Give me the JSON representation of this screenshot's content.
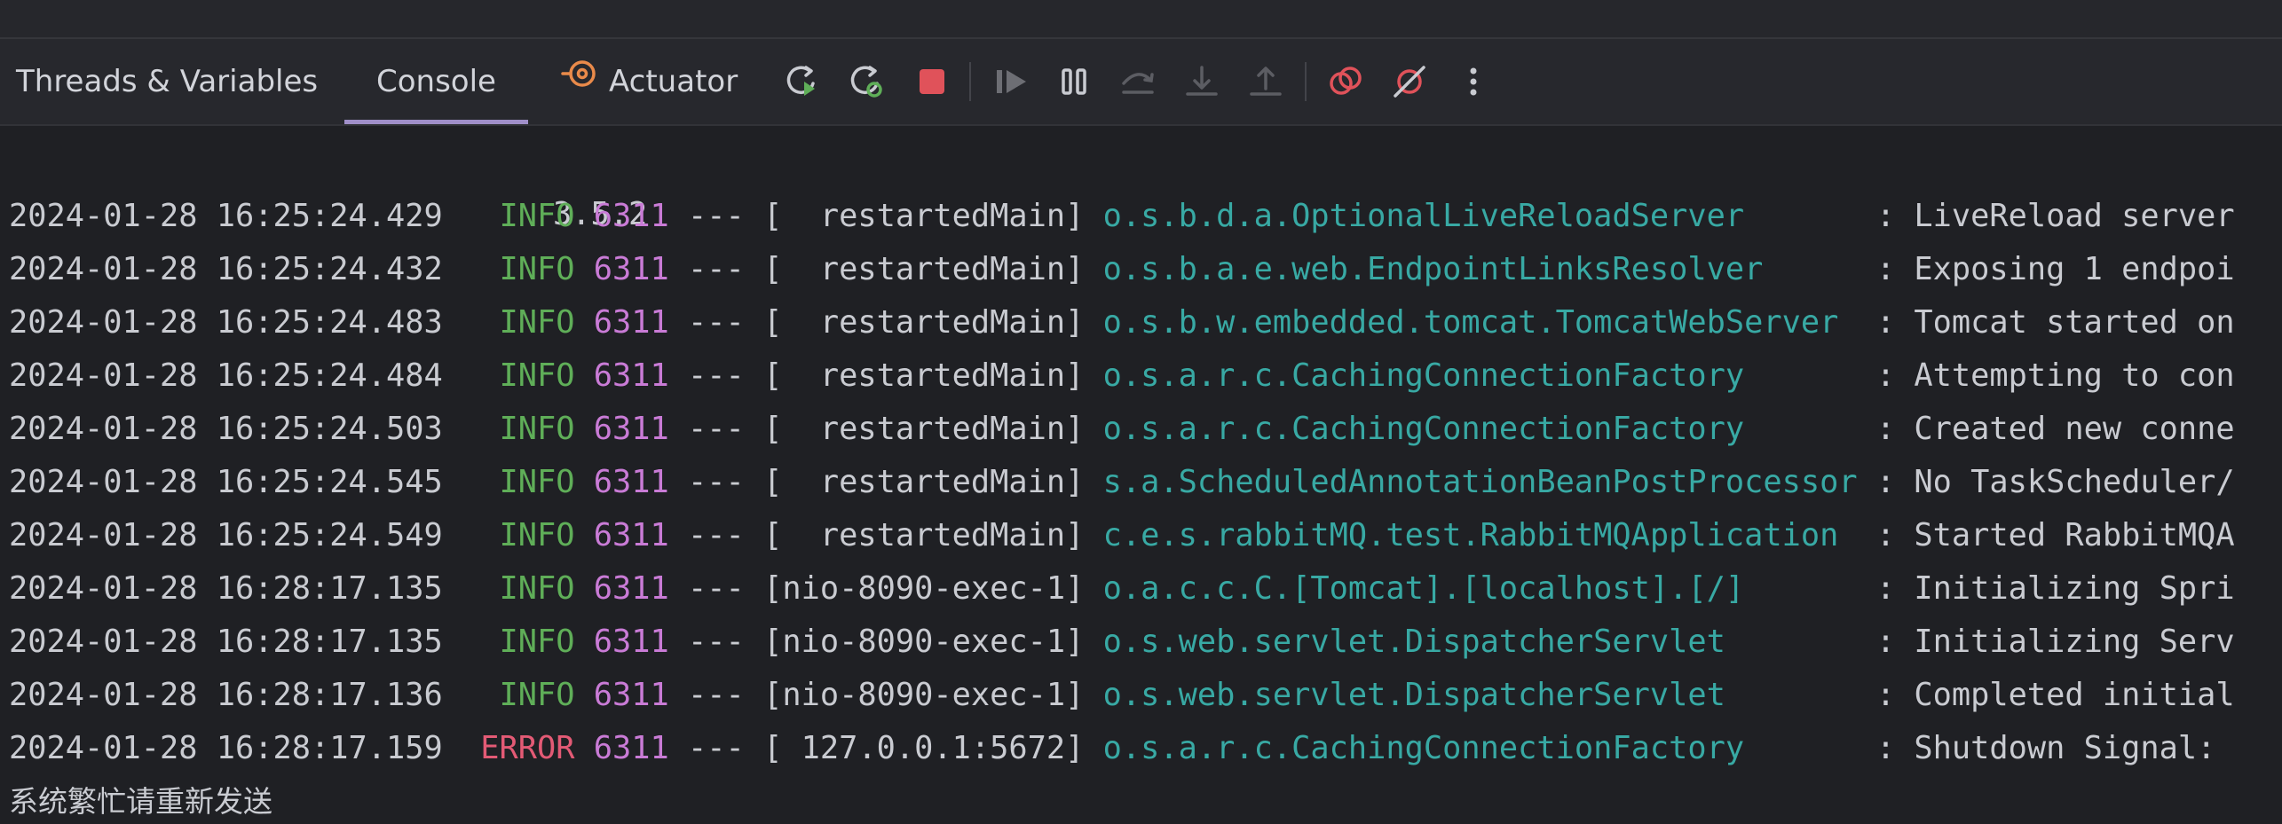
{
  "tabs": [
    {
      "label": "Threads & Variables"
    },
    {
      "label": "Console"
    },
    {
      "label": "Actuator"
    }
  ],
  "active_tab": "Console",
  "colors": {
    "info": "#5fae58",
    "error": "#e35a75",
    "pid": "#c97bd6",
    "logger": "#38a9a4",
    "text": "#c9cbd1",
    "tab_underline": "#a08fc9",
    "stop": "#e0525a"
  },
  "toolbar_icons": [
    "rerun-icon",
    "restart-icon",
    "stop-icon",
    "resume-icon",
    "pause-icon",
    "step-over-icon",
    "step-into-icon",
    "step-out-icon",
    "view-breakpoints-icon",
    "mute-breakpoints-icon",
    "more-icon"
  ],
  "console": {
    "version": "3.5.2",
    "lines": [
      {
        "ts": "2024-01-28 16:25:24.429",
        "level": "INFO",
        "pid": "6311",
        "sep": "---",
        "thread": "[  restartedMain]",
        "logger": "o.s.b.d.a.OptionalLiveReloadServer",
        "msg": ": LiveReload server"
      },
      {
        "ts": "2024-01-28 16:25:24.432",
        "level": "INFO",
        "pid": "6311",
        "sep": "---",
        "thread": "[  restartedMain]",
        "logger": "o.s.b.a.e.web.EndpointLinksResolver",
        "msg": ": Exposing 1 endpoi"
      },
      {
        "ts": "2024-01-28 16:25:24.483",
        "level": "INFO",
        "pid": "6311",
        "sep": "---",
        "thread": "[  restartedMain]",
        "logger": "o.s.b.w.embedded.tomcat.TomcatWebServer",
        "msg": ": Tomcat started on"
      },
      {
        "ts": "2024-01-28 16:25:24.484",
        "level": "INFO",
        "pid": "6311",
        "sep": "---",
        "thread": "[  restartedMain]",
        "logger": "o.s.a.r.c.CachingConnectionFactory",
        "msg": ": Attempting to con"
      },
      {
        "ts": "2024-01-28 16:25:24.503",
        "level": "INFO",
        "pid": "6311",
        "sep": "---",
        "thread": "[  restartedMain]",
        "logger": "o.s.a.r.c.CachingConnectionFactory",
        "msg": ": Created new conne"
      },
      {
        "ts": "2024-01-28 16:25:24.545",
        "level": "INFO",
        "pid": "6311",
        "sep": "---",
        "thread": "[  restartedMain]",
        "logger": "s.a.ScheduledAnnotationBeanPostProcessor",
        "msg": ": No TaskScheduler/"
      },
      {
        "ts": "2024-01-28 16:25:24.549",
        "level": "INFO",
        "pid": "6311",
        "sep": "---",
        "thread": "[  restartedMain]",
        "logger": "c.e.s.rabbitMQ.test.RabbitMQApplication",
        "msg": ": Started RabbitMQA"
      },
      {
        "ts": "2024-01-28 16:28:17.135",
        "level": "INFO",
        "pid": "6311",
        "sep": "---",
        "thread": "[nio-8090-exec-1]",
        "logger": "o.a.c.c.C.[Tomcat].[localhost].[/]",
        "msg": ": Initializing Spri"
      },
      {
        "ts": "2024-01-28 16:28:17.135",
        "level": "INFO",
        "pid": "6311",
        "sep": "---",
        "thread": "[nio-8090-exec-1]",
        "logger": "o.s.web.servlet.DispatcherServlet",
        "msg": ": Initializing Serv"
      },
      {
        "ts": "2024-01-28 16:28:17.136",
        "level": "INFO",
        "pid": "6311",
        "sep": "---",
        "thread": "[nio-8090-exec-1]",
        "logger": "o.s.web.servlet.DispatcherServlet",
        "msg": ": Completed initial"
      },
      {
        "ts": "2024-01-28 16:28:17.159",
        "level": "ERROR",
        "pid": "6311",
        "sep": "---",
        "thread": "[ 127.0.0.1:5672]",
        "logger": "o.s.a.r.c.CachingConnectionFactory",
        "msg": ": Shutdown Signal: "
      }
    ],
    "trailing_message": "系统繁忙请重新发送"
  }
}
